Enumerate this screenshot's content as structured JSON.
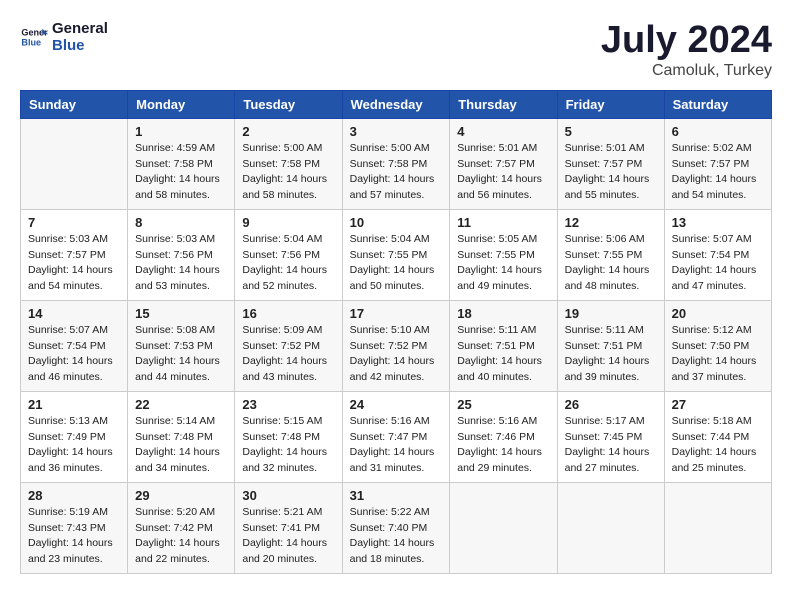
{
  "logo": {
    "line1": "General",
    "line2": "Blue"
  },
  "title": "July 2024",
  "subtitle": "Camoluk, Turkey",
  "header": {
    "accent_color": "#2255aa"
  },
  "days_of_week": [
    "Sunday",
    "Monday",
    "Tuesday",
    "Wednesday",
    "Thursday",
    "Friday",
    "Saturday"
  ],
  "weeks": [
    [
      {
        "day": "",
        "sunrise": "",
        "sunset": "",
        "daylight": ""
      },
      {
        "day": "1",
        "sunrise": "Sunrise: 4:59 AM",
        "sunset": "Sunset: 7:58 PM",
        "daylight": "Daylight: 14 hours and 58 minutes."
      },
      {
        "day": "2",
        "sunrise": "Sunrise: 5:00 AM",
        "sunset": "Sunset: 7:58 PM",
        "daylight": "Daylight: 14 hours and 58 minutes."
      },
      {
        "day": "3",
        "sunrise": "Sunrise: 5:00 AM",
        "sunset": "Sunset: 7:58 PM",
        "daylight": "Daylight: 14 hours and 57 minutes."
      },
      {
        "day": "4",
        "sunrise": "Sunrise: 5:01 AM",
        "sunset": "Sunset: 7:57 PM",
        "daylight": "Daylight: 14 hours and 56 minutes."
      },
      {
        "day": "5",
        "sunrise": "Sunrise: 5:01 AM",
        "sunset": "Sunset: 7:57 PM",
        "daylight": "Daylight: 14 hours and 55 minutes."
      },
      {
        "day": "6",
        "sunrise": "Sunrise: 5:02 AM",
        "sunset": "Sunset: 7:57 PM",
        "daylight": "Daylight: 14 hours and 54 minutes."
      }
    ],
    [
      {
        "day": "7",
        "sunrise": "Sunrise: 5:03 AM",
        "sunset": "Sunset: 7:57 PM",
        "daylight": "Daylight: 14 hours and 54 minutes."
      },
      {
        "day": "8",
        "sunrise": "Sunrise: 5:03 AM",
        "sunset": "Sunset: 7:56 PM",
        "daylight": "Daylight: 14 hours and 53 minutes."
      },
      {
        "day": "9",
        "sunrise": "Sunrise: 5:04 AM",
        "sunset": "Sunset: 7:56 PM",
        "daylight": "Daylight: 14 hours and 52 minutes."
      },
      {
        "day": "10",
        "sunrise": "Sunrise: 5:04 AM",
        "sunset": "Sunset: 7:55 PM",
        "daylight": "Daylight: 14 hours and 50 minutes."
      },
      {
        "day": "11",
        "sunrise": "Sunrise: 5:05 AM",
        "sunset": "Sunset: 7:55 PM",
        "daylight": "Daylight: 14 hours and 49 minutes."
      },
      {
        "day": "12",
        "sunrise": "Sunrise: 5:06 AM",
        "sunset": "Sunset: 7:55 PM",
        "daylight": "Daylight: 14 hours and 48 minutes."
      },
      {
        "day": "13",
        "sunrise": "Sunrise: 5:07 AM",
        "sunset": "Sunset: 7:54 PM",
        "daylight": "Daylight: 14 hours and 47 minutes."
      }
    ],
    [
      {
        "day": "14",
        "sunrise": "Sunrise: 5:07 AM",
        "sunset": "Sunset: 7:54 PM",
        "daylight": "Daylight: 14 hours and 46 minutes."
      },
      {
        "day": "15",
        "sunrise": "Sunrise: 5:08 AM",
        "sunset": "Sunset: 7:53 PM",
        "daylight": "Daylight: 14 hours and 44 minutes."
      },
      {
        "day": "16",
        "sunrise": "Sunrise: 5:09 AM",
        "sunset": "Sunset: 7:52 PM",
        "daylight": "Daylight: 14 hours and 43 minutes."
      },
      {
        "day": "17",
        "sunrise": "Sunrise: 5:10 AM",
        "sunset": "Sunset: 7:52 PM",
        "daylight": "Daylight: 14 hours and 42 minutes."
      },
      {
        "day": "18",
        "sunrise": "Sunrise: 5:11 AM",
        "sunset": "Sunset: 7:51 PM",
        "daylight": "Daylight: 14 hours and 40 minutes."
      },
      {
        "day": "19",
        "sunrise": "Sunrise: 5:11 AM",
        "sunset": "Sunset: 7:51 PM",
        "daylight": "Daylight: 14 hours and 39 minutes."
      },
      {
        "day": "20",
        "sunrise": "Sunrise: 5:12 AM",
        "sunset": "Sunset: 7:50 PM",
        "daylight": "Daylight: 14 hours and 37 minutes."
      }
    ],
    [
      {
        "day": "21",
        "sunrise": "Sunrise: 5:13 AM",
        "sunset": "Sunset: 7:49 PM",
        "daylight": "Daylight: 14 hours and 36 minutes."
      },
      {
        "day": "22",
        "sunrise": "Sunrise: 5:14 AM",
        "sunset": "Sunset: 7:48 PM",
        "daylight": "Daylight: 14 hours and 34 minutes."
      },
      {
        "day": "23",
        "sunrise": "Sunrise: 5:15 AM",
        "sunset": "Sunset: 7:48 PM",
        "daylight": "Daylight: 14 hours and 32 minutes."
      },
      {
        "day": "24",
        "sunrise": "Sunrise: 5:16 AM",
        "sunset": "Sunset: 7:47 PM",
        "daylight": "Daylight: 14 hours and 31 minutes."
      },
      {
        "day": "25",
        "sunrise": "Sunrise: 5:16 AM",
        "sunset": "Sunset: 7:46 PM",
        "daylight": "Daylight: 14 hours and 29 minutes."
      },
      {
        "day": "26",
        "sunrise": "Sunrise: 5:17 AM",
        "sunset": "Sunset: 7:45 PM",
        "daylight": "Daylight: 14 hours and 27 minutes."
      },
      {
        "day": "27",
        "sunrise": "Sunrise: 5:18 AM",
        "sunset": "Sunset: 7:44 PM",
        "daylight": "Daylight: 14 hours and 25 minutes."
      }
    ],
    [
      {
        "day": "28",
        "sunrise": "Sunrise: 5:19 AM",
        "sunset": "Sunset: 7:43 PM",
        "daylight": "Daylight: 14 hours and 23 minutes."
      },
      {
        "day": "29",
        "sunrise": "Sunrise: 5:20 AM",
        "sunset": "Sunset: 7:42 PM",
        "daylight": "Daylight: 14 hours and 22 minutes."
      },
      {
        "day": "30",
        "sunrise": "Sunrise: 5:21 AM",
        "sunset": "Sunset: 7:41 PM",
        "daylight": "Daylight: 14 hours and 20 minutes."
      },
      {
        "day": "31",
        "sunrise": "Sunrise: 5:22 AM",
        "sunset": "Sunset: 7:40 PM",
        "daylight": "Daylight: 14 hours and 18 minutes."
      },
      {
        "day": "",
        "sunrise": "",
        "sunset": "",
        "daylight": ""
      },
      {
        "day": "",
        "sunrise": "",
        "sunset": "",
        "daylight": ""
      },
      {
        "day": "",
        "sunrise": "",
        "sunset": "",
        "daylight": ""
      }
    ]
  ]
}
